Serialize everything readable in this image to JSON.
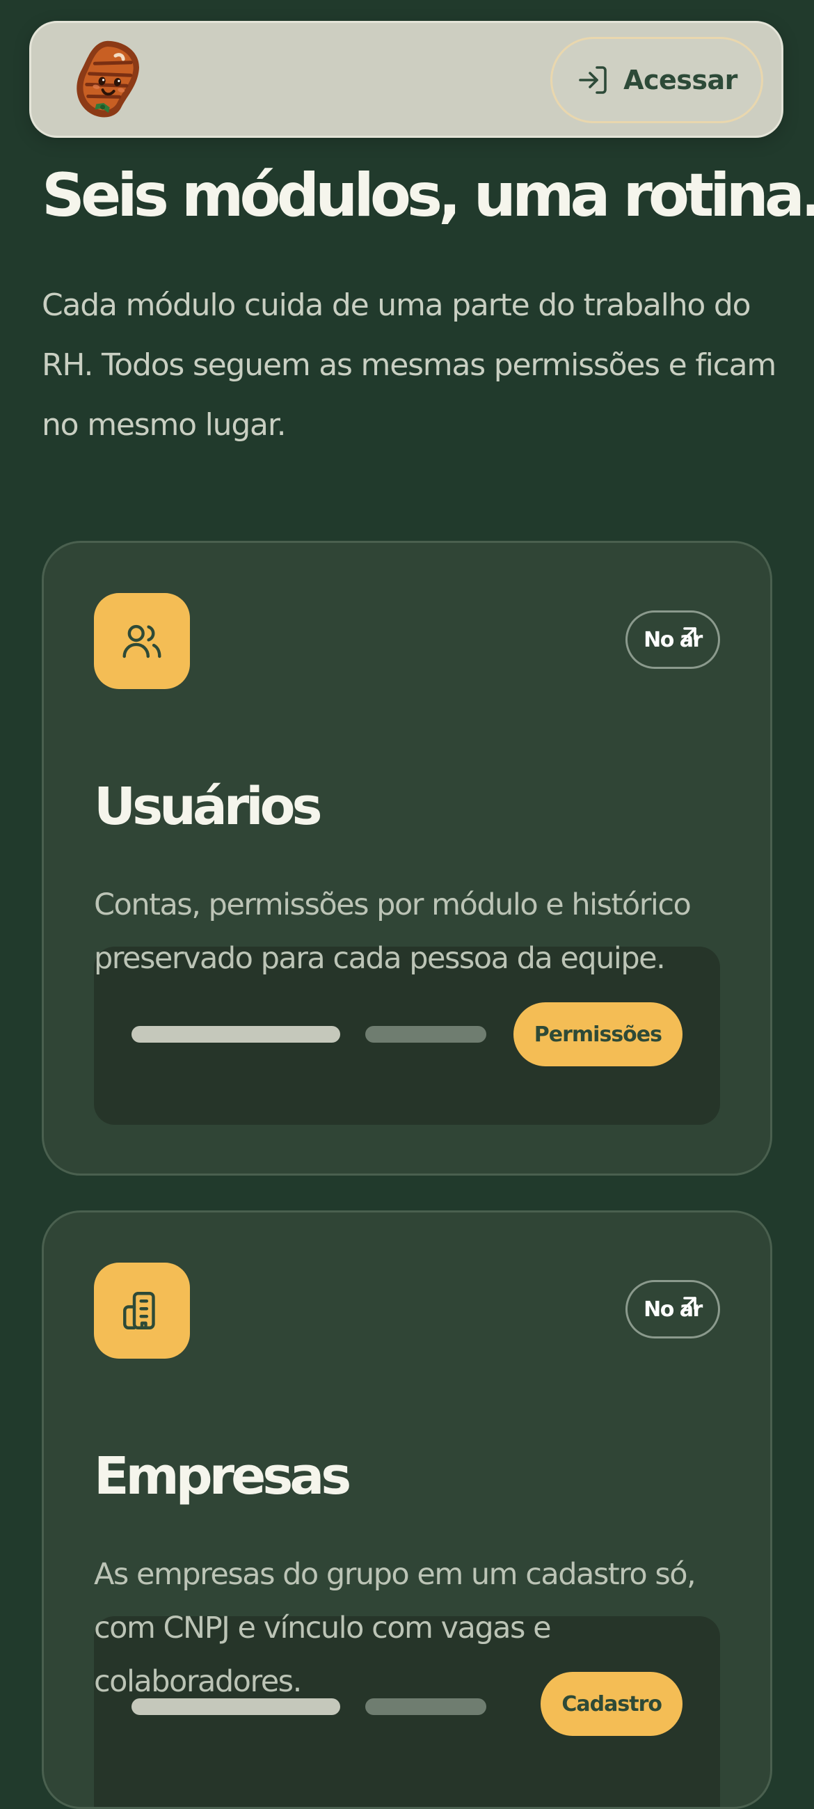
{
  "header": {
    "logo_icon": "steak-mascot-icon",
    "login_icon": "sign-in-icon",
    "login_label": "Acessar"
  },
  "hero": {
    "title": "Seis módulos, uma rotina.",
    "description": "Cada módulo cuida de uma parte do trabalho do RH. Todos seguem as mesmas permissões e ficam no mesmo lugar."
  },
  "modules": [
    {
      "icon": "users-icon",
      "status": "No ar",
      "status_icon": "arrow-up-right-icon",
      "title": "Usuários",
      "description": "Contas, permissões por módulo e histórico preservado para cada pessoa da equipe.",
      "action_label": "Permissões"
    },
    {
      "icon": "building-icon",
      "status": "No ar",
      "status_icon": "arrow-up-right-icon",
      "title": "Empresas",
      "description": "As empresas do grupo em um cadastro só, com CNPJ e vínculo com vagas e colaboradores.",
      "action_label": "Cadastro"
    }
  ],
  "colors": {
    "background": "#213a2c",
    "card": "#304536",
    "accent": "#f4bd55",
    "header_bg": "#cdcec1",
    "text_primary": "#f5f5ec",
    "text_muted": "#bcc4b6"
  }
}
